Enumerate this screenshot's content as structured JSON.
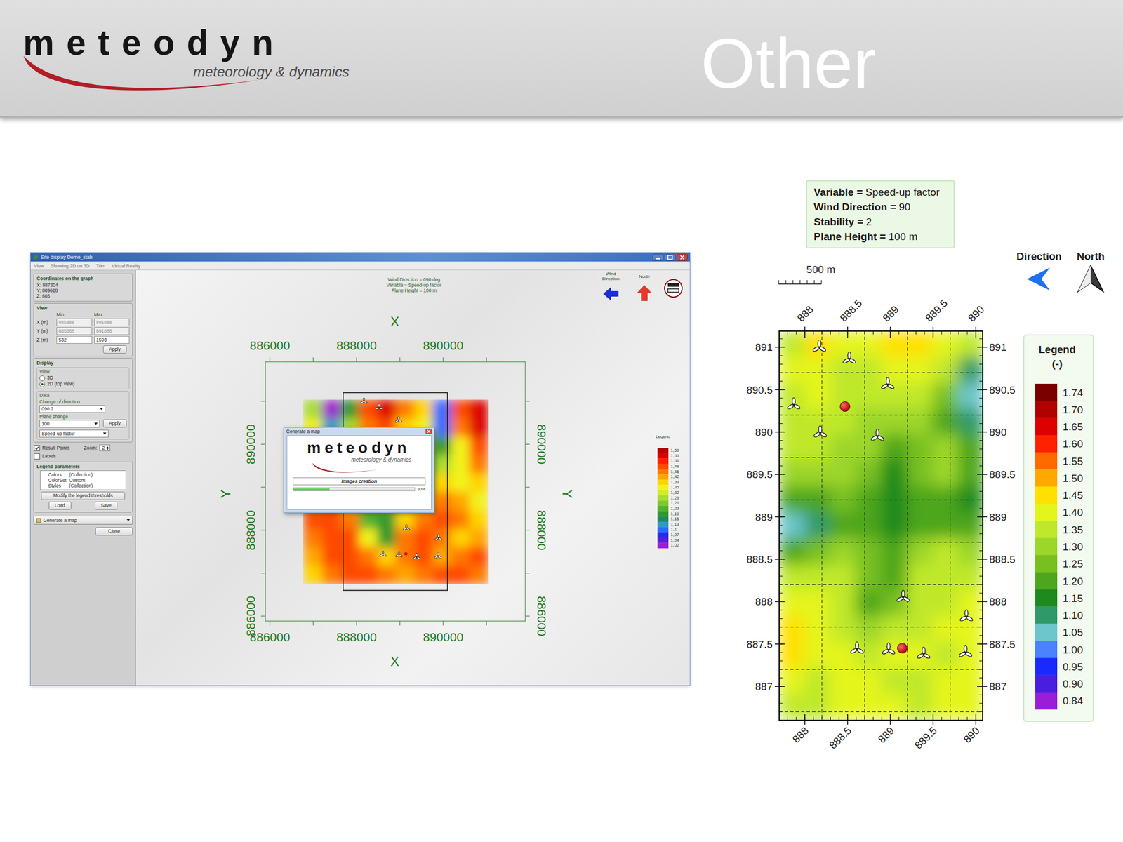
{
  "header": {
    "logo": {
      "word": "meteodyn",
      "tagline": "meteorology & dynamics"
    },
    "title": "Other"
  },
  "app": {
    "window": {
      "title": "Site display Demo_stab"
    },
    "menu": [
      "View",
      "Showing 2D on 3D",
      "Trim",
      "Virtual Reality"
    ],
    "sidebar": {
      "coordinates": {
        "title": "Coordinates on the graph",
        "lines": [
          "X: 887304",
          "Y: 889628",
          "Z: 603"
        ]
      },
      "view": {
        "title": "View",
        "columns": [
          "Min",
          "Max"
        ],
        "rows": [
          {
            "label": "X (m)",
            "min": "885888",
            "max": "891888",
            "disabled": true
          },
          {
            "label": "Y (m)",
            "min": "885888",
            "max": "891888",
            "disabled": true
          },
          {
            "label": "Z (m)",
            "min": "532",
            "max": "1593",
            "disabled": false
          }
        ],
        "apply": "Apply"
      },
      "display": {
        "title": "Display",
        "view_title": "View",
        "options": [
          {
            "label": "3D",
            "selected": false
          },
          {
            "label": "2D (top view)",
            "selected": true
          }
        ],
        "data_title": "Data",
        "direction_label": "Change of direction",
        "direction_value": "090 2",
        "plane_label": "Plane change",
        "plane_value": "100",
        "apply": "Apply",
        "variable_value": "Speed-up factor"
      },
      "checks": [
        {
          "label": "Result Points",
          "checked": true
        },
        {
          "label": "Labels",
          "checked": false
        }
      ],
      "zoom": {
        "label": "Zoom:",
        "value": "2"
      },
      "legend_params": {
        "title": "Legend parameters",
        "rows": [
          {
            "key": "Colors",
            "value": "(Collection)"
          },
          {
            "key": "ColorSet",
            "value": "Custom"
          },
          {
            "key": "Styles",
            "value": "(Collection)"
          }
        ],
        "modify": "Modify the legend thresholds",
        "load": "Load",
        "save": "Save"
      },
      "generate": "Generate a map",
      "close": "Close"
    },
    "chart": {
      "info": [
        "Wind Direction = 090 deg",
        "Variable = Speed-up factor",
        "Plane Height = 100 m"
      ],
      "wind_label": "Wind",
      "wind_label2": "Direction",
      "north_label": "North",
      "axis_x": "X",
      "axis_y": "Y",
      "x_ticks": [
        "886000",
        "888000",
        "890000"
      ],
      "y_ticks": [
        "890000",
        "888000",
        "886000"
      ],
      "legend_title": "Legend",
      "legend": [
        {
          "label": "1,59",
          "color": "#b40000"
        },
        {
          "label": "1,55",
          "color": "#dc0000"
        },
        {
          "label": "1,51",
          "color": "#ff1e00"
        },
        {
          "label": "1,48",
          "color": "#ff4a00"
        },
        {
          "label": "1,45",
          "color": "#ff7800"
        },
        {
          "label": "1,42",
          "color": "#ffa600"
        },
        {
          "label": "1,39",
          "color": "#ffd400"
        },
        {
          "label": "1,35",
          "color": "#f2f21a"
        },
        {
          "label": "1,32",
          "color": "#d0ec2a"
        },
        {
          "label": "1,29",
          "color": "#a8dc2e"
        },
        {
          "label": "1,26",
          "color": "#7ec82e"
        },
        {
          "label": "1,23",
          "color": "#52b22e"
        },
        {
          "label": "1,19",
          "color": "#2e9a2e"
        },
        {
          "label": "1,16",
          "color": "#228a5a"
        },
        {
          "label": "1,13",
          "color": "#2a9cc8"
        },
        {
          "label": "1,1",
          "color": "#2a6cff"
        },
        {
          "label": "1,07",
          "color": "#2030e8"
        },
        {
          "label": "1,04",
          "color": "#5a1ee0"
        },
        {
          "label": "1,02",
          "color": "#a01ed0"
        }
      ],
      "grid": [
        [
          1.3,
          1.03,
          1.2,
          1.5,
          1.55,
          1.45,
          1.4,
          1.1,
          1.5,
          1.58
        ],
        [
          1.35,
          1.15,
          1.3,
          1.45,
          1.48,
          1.4,
          1.35,
          1.12,
          1.45,
          1.55
        ],
        [
          1.4,
          1.3,
          1.35,
          1.42,
          1.4,
          1.35,
          1.3,
          1.2,
          1.38,
          1.5
        ],
        [
          1.45,
          1.4,
          1.38,
          1.35,
          1.3,
          1.25,
          1.28,
          1.3,
          1.35,
          1.45
        ],
        [
          1.35,
          1.3,
          1.25,
          1.22,
          1.2,
          1.22,
          1.3,
          1.4,
          1.38,
          1.4
        ],
        [
          1.42,
          1.45,
          1.35,
          1.28,
          1.3,
          1.35,
          1.4,
          1.45,
          1.42,
          1.38
        ],
        [
          1.48,
          1.5,
          1.45,
          1.25,
          1.2,
          1.4,
          1.45,
          1.48,
          1.45,
          1.4
        ],
        [
          1.45,
          1.5,
          1.48,
          1.35,
          1.22,
          1.45,
          1.5,
          1.45,
          1.4,
          1.42
        ],
        [
          1.42,
          1.48,
          1.5,
          1.45,
          1.4,
          1.45,
          1.48,
          1.42,
          1.45,
          1.48
        ],
        [
          1.4,
          1.45,
          1.48,
          1.5,
          1.45,
          1.42,
          1.45,
          1.48,
          1.5,
          1.45
        ]
      ]
    },
    "dialog": {
      "title": "Generate a map",
      "logo": {
        "word": "meteodyn",
        "tagline": "meteorology & dynamics"
      },
      "progress": {
        "label": "Images creation",
        "level": 0.3,
        "reading": "30%"
      }
    }
  },
  "site_map": {
    "info": [
      {
        "key": "Variable =",
        "value": "Speed-up factor"
      },
      {
        "key": "Wind Direction =",
        "value": "90"
      },
      {
        "key": "Stability =",
        "value": "2"
      },
      {
        "key": "Plane Height =",
        "value": "100 m"
      }
    ],
    "scale": "500 m",
    "direction_label": "Direction",
    "north_label": "North",
    "x_ticks": [
      "888",
      "888.5",
      "889",
      "889.5",
      "890"
    ],
    "y_ticks": [
      "891",
      "890.5",
      "890",
      "889.5",
      "889",
      "888.5",
      "888",
      "887.5",
      "887"
    ],
    "legend_title": "Legend",
    "legend_unit": "(-)",
    "legend": [
      {
        "label": "1.74",
        "color": "#7a0000"
      },
      {
        "label": "1.70",
        "color": "#b00000"
      },
      {
        "label": "1.65",
        "color": "#dc0000"
      },
      {
        "label": "1.60",
        "color": "#ff2200"
      },
      {
        "label": "1.55",
        "color": "#ff6a00"
      },
      {
        "label": "1.50",
        "color": "#ffa800"
      },
      {
        "label": "1.45",
        "color": "#ffe000"
      },
      {
        "label": "1.40",
        "color": "#e4f51e"
      },
      {
        "label": "1.35",
        "color": "#bfe82a"
      },
      {
        "label": "1.30",
        "color": "#9cd62a"
      },
      {
        "label": "1.25",
        "color": "#78c020"
      },
      {
        "label": "1.20",
        "color": "#4ea61e"
      },
      {
        "label": "1.15",
        "color": "#1e8a1e"
      },
      {
        "label": "1.10",
        "color": "#2e9a6a"
      },
      {
        "label": "1.05",
        "color": "#6cc6cc"
      },
      {
        "label": "1.00",
        "color": "#4a82ff"
      },
      {
        "label": "0.95",
        "color": "#1a2aff"
      },
      {
        "label": "0.90",
        "color": "#4a1ee0"
      },
      {
        "label": "0.84",
        "color": "#9a1ed8"
      }
    ],
    "grid": [
      [
        1.38,
        1.45,
        1.42,
        1.4,
        1.45,
        1.47,
        1.42,
        1.35
      ],
      [
        1.4,
        1.42,
        1.38,
        1.38,
        1.4,
        1.42,
        1.35,
        1.1
      ],
      [
        1.38,
        1.4,
        1.38,
        1.36,
        1.35,
        1.38,
        1.25,
        1.05
      ],
      [
        1.36,
        1.38,
        1.36,
        1.34,
        1.3,
        1.32,
        1.2,
        1.1
      ],
      [
        1.35,
        1.36,
        1.34,
        1.3,
        1.22,
        1.28,
        1.3,
        1.2
      ],
      [
        1.3,
        1.32,
        1.32,
        1.25,
        1.18,
        1.25,
        1.3,
        1.2
      ],
      [
        1.2,
        1.22,
        1.25,
        1.2,
        1.15,
        1.2,
        1.22,
        1.18
      ],
      [
        1.05,
        1.12,
        1.2,
        1.22,
        1.18,
        1.2,
        1.22,
        1.2
      ],
      [
        1.2,
        1.25,
        1.3,
        1.28,
        1.2,
        1.3,
        1.35,
        1.3
      ],
      [
        1.35,
        1.38,
        1.35,
        1.28,
        1.22,
        1.35,
        1.38,
        1.35
      ],
      [
        1.42,
        1.4,
        1.36,
        1.22,
        1.25,
        1.35,
        1.38,
        1.4
      ],
      [
        1.45,
        1.42,
        1.38,
        1.3,
        1.35,
        1.38,
        1.4,
        1.42
      ],
      [
        1.45,
        1.4,
        1.4,
        1.38,
        1.4,
        1.4,
        1.38,
        1.4
      ],
      [
        1.4,
        1.38,
        1.4,
        1.4,
        1.38,
        1.38,
        1.4,
        1.4
      ],
      [
        1.38,
        1.38,
        1.4,
        1.4,
        1.4,
        1.38,
        1.4,
        1.4
      ]
    ]
  },
  "turbines": [
    {
      "x": 888.17,
      "y": 891.0
    },
    {
      "x": 888.52,
      "y": 890.86
    },
    {
      "x": 888.97,
      "y": 890.56
    },
    {
      "x": 887.87,
      "y": 890.32
    },
    {
      "x": 888.18,
      "y": 889.99
    },
    {
      "x": 888.85,
      "y": 889.95
    },
    {
      "x": 889.15,
      "y": 888.05
    },
    {
      "x": 889.89,
      "y": 887.82
    },
    {
      "x": 888.61,
      "y": 887.44
    },
    {
      "x": 888.98,
      "y": 887.43
    },
    {
      "x": 889.39,
      "y": 887.38
    },
    {
      "x": 889.88,
      "y": 887.4
    }
  ],
  "measurement_points": [
    {
      "x": 888.47,
      "y": 890.3
    },
    {
      "x": 889.14,
      "y": 887.45
    }
  ]
}
